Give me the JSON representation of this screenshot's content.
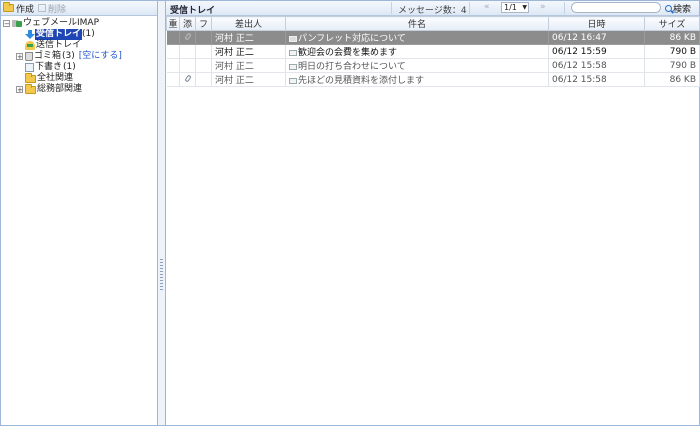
{
  "left_toolbar": {
    "compose_label": "作成",
    "delete_label": "削除"
  },
  "tree": {
    "root": "ウェブメールIMAP",
    "inbox": {
      "label": "受信トレイ",
      "count": "(1)"
    },
    "sent": {
      "label": "送信トレイ"
    },
    "trash": {
      "label": "ゴミ箱",
      "count": "(3)",
      "empty_link": "[空にする]"
    },
    "drafts": {
      "label": "下書き",
      "count": "(1)"
    },
    "folder1": {
      "label": "全社関連"
    },
    "folder2": {
      "label": "総務部関連"
    }
  },
  "right_toolbar": {
    "title": "受信トレイ",
    "message_count": "メッセージ数：4",
    "prev": "«",
    "page": "1/1",
    "next": "»",
    "search_label": "検索",
    "search_placeholder": ""
  },
  "columns": {
    "important": "重",
    "attach": "添",
    "flag": "フ",
    "sender": "差出人",
    "subject": "件名",
    "date": "日時",
    "size": "サイズ"
  },
  "messages": [
    {
      "sender": "河村 正二",
      "subject": "パンフレット対応について",
      "date": "06/12 16:47",
      "size": "86 KB"
    },
    {
      "sender": "河村 正二",
      "subject": "歓迎会の会費を集めます",
      "date": "06/12 15:59",
      "size": "790 B"
    },
    {
      "sender": "河村 正二",
      "subject": "明日の打ち合わせについて",
      "date": "06/12 15:58",
      "size": "790 B"
    },
    {
      "sender": "河村 正二",
      "subject": "先ほどの見積資料を添付します",
      "date": "06/12 15:58",
      "size": "86 KB"
    }
  ]
}
